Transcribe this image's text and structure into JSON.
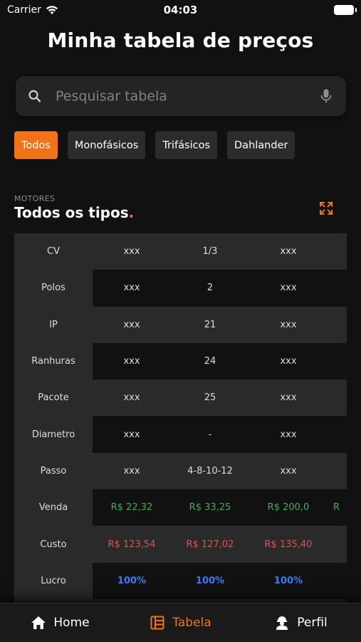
{
  "status": {
    "carrier": "Carrier",
    "time": "04:03"
  },
  "header": {
    "title": "Minha tabela de preços"
  },
  "search": {
    "placeholder": "Pesquisar tabela"
  },
  "filters": [
    {
      "label": "Todos",
      "active": true
    },
    {
      "label": "Monofásicos",
      "active": false
    },
    {
      "label": "Trifásicos",
      "active": false
    },
    {
      "label": "Dahlander",
      "active": false
    }
  ],
  "section": {
    "kicker": "MOTORES",
    "title": "Todos os tipos",
    "title_dot": "."
  },
  "table": {
    "rows": [
      {
        "label": "CV",
        "values": [
          "xxx",
          "1/3",
          "xxx",
          ""
        ],
        "tone": ""
      },
      {
        "label": "Polos",
        "values": [
          "xxx",
          "2",
          "xxx",
          ""
        ],
        "tone": ""
      },
      {
        "label": "IP",
        "values": [
          "xxx",
          "21",
          "xxx",
          ""
        ],
        "tone": ""
      },
      {
        "label": "Ranhuras",
        "values": [
          "xxx",
          "24",
          "xxx",
          ""
        ],
        "tone": ""
      },
      {
        "label": "Pacote",
        "values": [
          "xxx",
          "25",
          "xxx",
          ""
        ],
        "tone": ""
      },
      {
        "label": "Diametro",
        "values": [
          "xxx",
          "-",
          "xxx",
          ""
        ],
        "tone": ""
      },
      {
        "label": "Passo",
        "values": [
          "xxx",
          "4-8-10-12",
          "xxx",
          ""
        ],
        "tone": ""
      },
      {
        "label": "Venda",
        "values": [
          "R$ 22,32",
          "R$ 33,25",
          "R$ 200,0",
          "R"
        ],
        "tone": "green"
      },
      {
        "label": "Custo",
        "values": [
          "R$ 123,54",
          "R$ 127,02",
          "R$ 135,40",
          ""
        ],
        "tone": "red"
      },
      {
        "label": "Lucro",
        "values": [
          "100%",
          "100%",
          "100%",
          ""
        ],
        "tone": "blue"
      }
    ]
  },
  "tabbar": [
    {
      "label": "Home",
      "icon": "home-icon",
      "active": false
    },
    {
      "label": "Tabela",
      "icon": "table-icon",
      "active": true
    },
    {
      "label": "Perfil",
      "icon": "user-icon",
      "active": false
    }
  ],
  "colors": {
    "accent": "#f17316",
    "background": "#111111",
    "surface": "#2a2a2a"
  }
}
